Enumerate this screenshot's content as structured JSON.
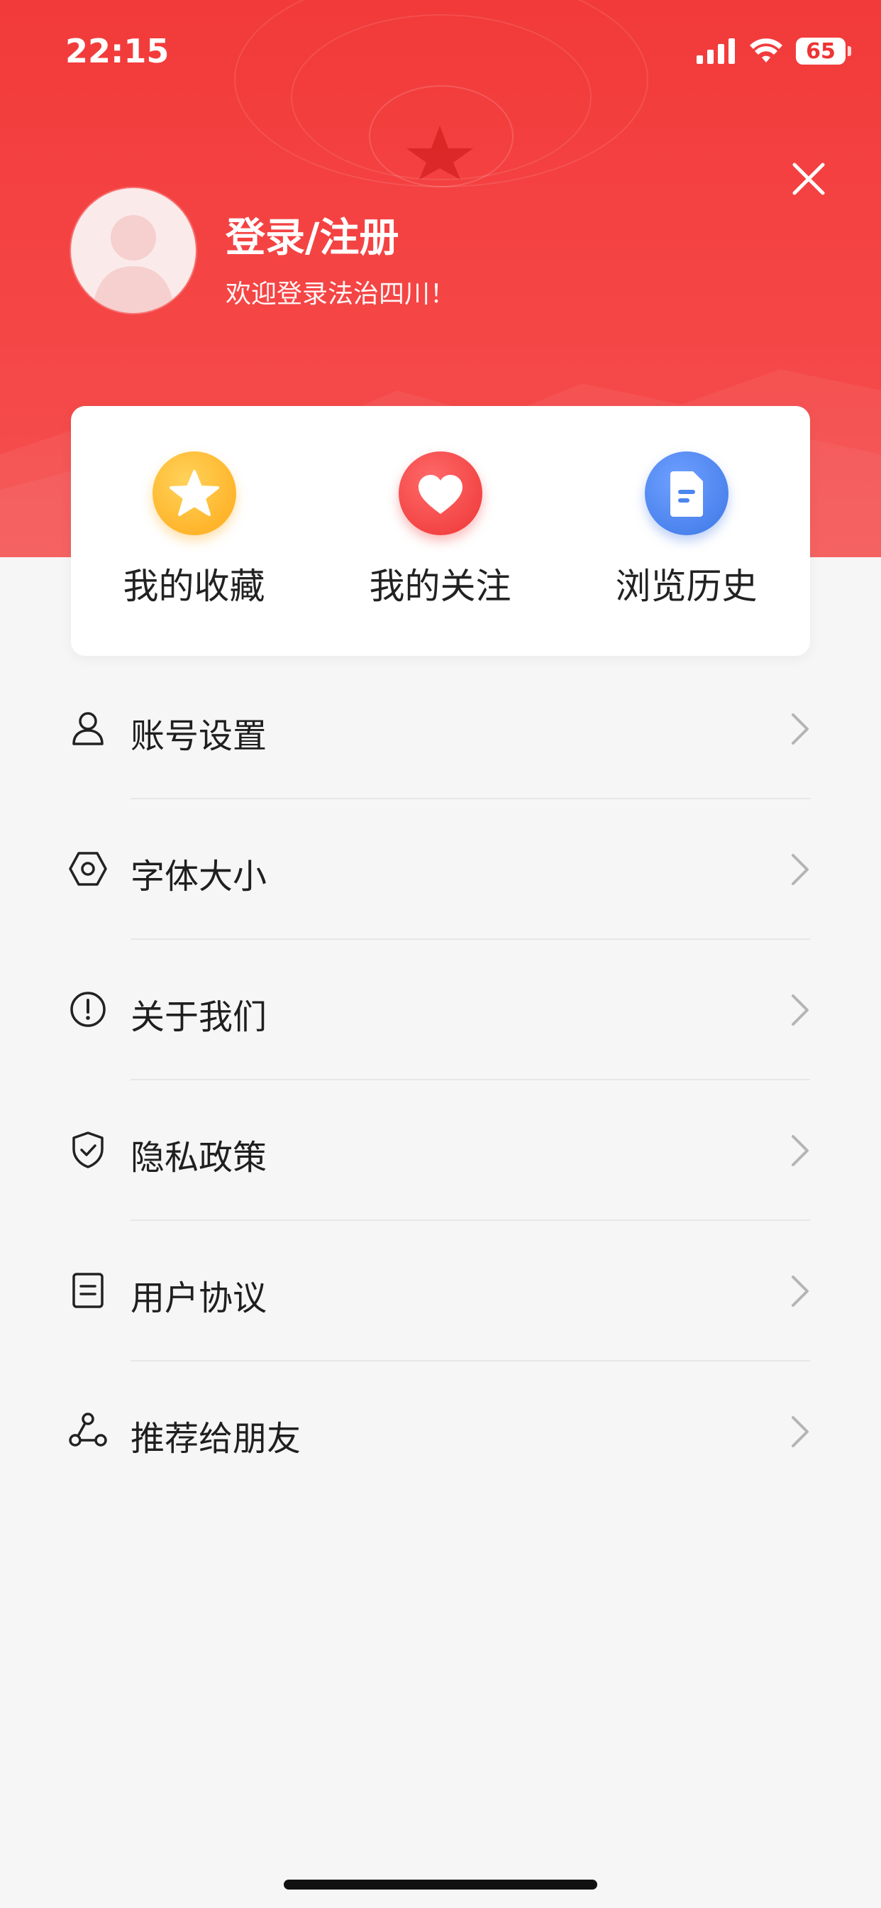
{
  "status_bar": {
    "time": "22:15",
    "battery": "65"
  },
  "profile": {
    "title": "登录/注册",
    "subtitle": "欢迎登录法治四川！"
  },
  "quick_actions": [
    {
      "label": "我的收藏",
      "icon": "star-icon",
      "color": "#ffb21e"
    },
    {
      "label": "我的关注",
      "icon": "heart-icon",
      "color": "#f34040"
    },
    {
      "label": "浏览历史",
      "icon": "document-icon",
      "color": "#4b86ee"
    }
  ],
  "menu": [
    {
      "label": "账号设置",
      "icon": "user-icon"
    },
    {
      "label": "字体大小",
      "icon": "hexagon-settings-icon"
    },
    {
      "label": "关于我们",
      "icon": "info-circle-icon"
    },
    {
      "label": "隐私政策",
      "icon": "shield-check-icon"
    },
    {
      "label": "用户协议",
      "icon": "document-lines-icon"
    },
    {
      "label": "推荐给朋友",
      "icon": "share-icon"
    }
  ],
  "colors": {
    "brand_red": "#f23a3a",
    "background": "#f6f6f6"
  }
}
